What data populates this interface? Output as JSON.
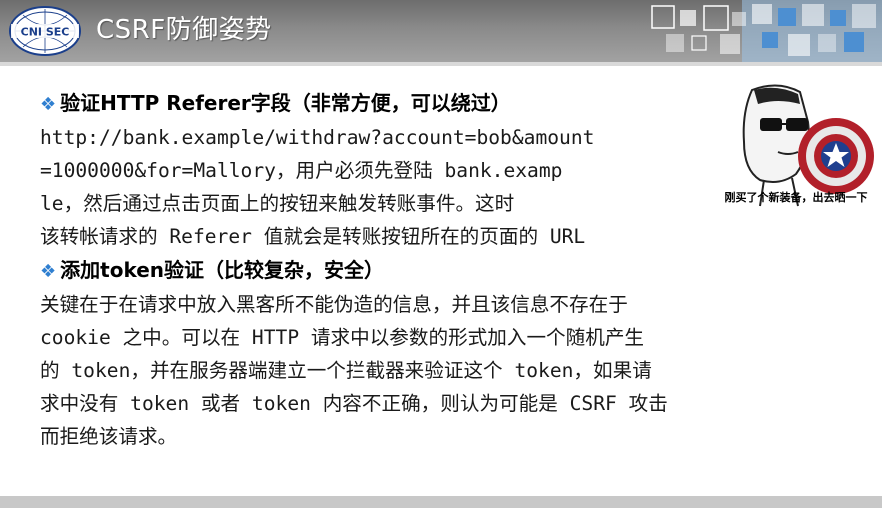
{
  "header": {
    "title": "CSRF防御姿势",
    "logo_text": "CNI SEC"
  },
  "section1": {
    "heading": "验证HTTP Referer字段（非常方便，可以绕过）",
    "lines": [
      "http://bank.example/withdraw?account=bob&amount",
      "=1000000&for=Mallory，用户必须先登陆 bank.examp",
      "le，然后通过点击页面上的按钮来触发转账事件。这时",
      "该转帐请求的 Referer 值就会是转账按钮所在的页面的 URL"
    ]
  },
  "section2": {
    "heading": "添加token验证（比较复杂，安全）",
    "lines": [
      "关键在于在请求中放入黑客所不能伪造的信息，并且该信息不存在于",
      "cookie 之中。可以在 HTTP 请求中以参数的形式加入一个随机产生",
      "的 token，并在服务器端建立一个拦截器来验证这个 token，如果请",
      "求中没有 token 或者 token 内容不正确，则认为可能是 CSRF 攻击",
      "而拒绝该请求。"
    ]
  },
  "meme": {
    "caption": "刚买了个新装备，出去晒一下"
  },
  "icons": {
    "bullet": "diamond-bullet-icon",
    "shield": "captain-america-shield-icon"
  },
  "colors": {
    "header": "#8a8a8a",
    "bullet": "#2f7fd0",
    "text": "#1a1a1a"
  }
}
